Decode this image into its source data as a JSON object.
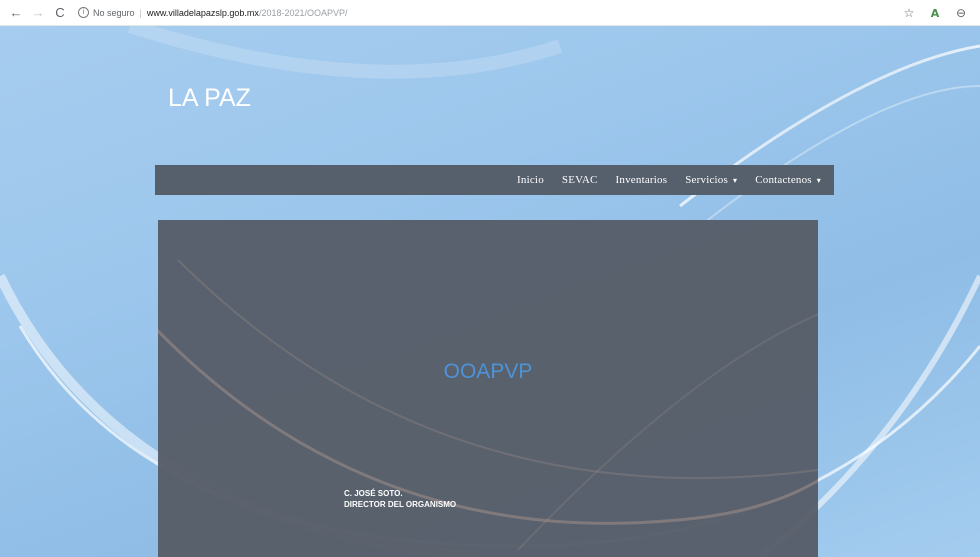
{
  "browser": {
    "back_icon": "arrow-left-icon",
    "forward_icon": "arrow-right-icon",
    "reload_icon": "reload-icon",
    "security_label": "No seguro",
    "url_domain": "www.villadelapazslp.gob.mx",
    "url_path": "/2018-2021/OOAPVP/",
    "back_glyph": "←",
    "forward_glyph": "→",
    "reload_glyph": "C",
    "info_glyph": "i",
    "separator": "|",
    "star_glyph": "☆",
    "translate_glyph": "A",
    "account_glyph": "⊖"
  },
  "site": {
    "title": "LA PAZ"
  },
  "nav": {
    "items": [
      {
        "label": "Inicio",
        "has_dropdown": false
      },
      {
        "label": "SEVAC",
        "has_dropdown": false
      },
      {
        "label": "Inventarios",
        "has_dropdown": false
      },
      {
        "label": "Servicios",
        "has_dropdown": true
      },
      {
        "label": "Contactenos",
        "has_dropdown": true
      }
    ],
    "caret_glyph": "▾"
  },
  "panel": {
    "title": "OOAPVP",
    "director_name": "C. JOSÉ SOTO.",
    "director_role": "DIRECTOR DEL ORGANISMO"
  },
  "colors": {
    "background": "#9cc6ec",
    "navbar": "#565f6c",
    "panel": "#565d68",
    "panel_title": "#4d93d6",
    "text_light": "#ffffff"
  }
}
